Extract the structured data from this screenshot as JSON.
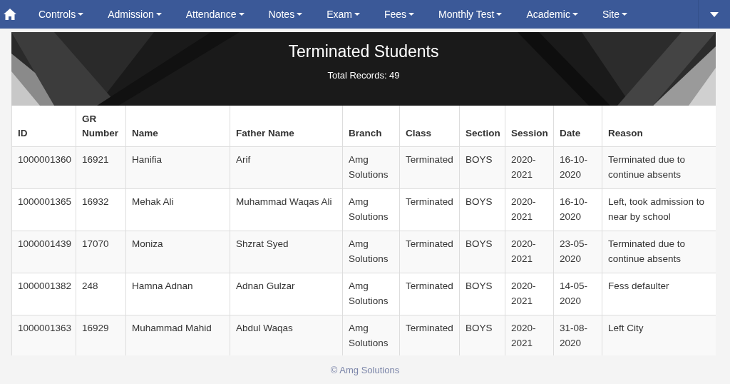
{
  "navbar": {
    "items": [
      {
        "label": "Controls"
      },
      {
        "label": "Admission"
      },
      {
        "label": "Attendance"
      },
      {
        "label": "Notes"
      },
      {
        "label": "Exam"
      },
      {
        "label": "Fees"
      },
      {
        "label": "Monthly Test"
      },
      {
        "label": "Academic"
      },
      {
        "label": "Site"
      }
    ]
  },
  "banner": {
    "title": "Terminated Students",
    "subtitle": "Total Records: 49"
  },
  "table": {
    "columns": [
      "ID",
      "GR Number",
      "Name",
      "Father Name",
      "Branch",
      "Class",
      "Section",
      "Session",
      "Date",
      "Reason"
    ],
    "rows": [
      [
        "1000001360",
        "16921",
        "Hanifia",
        "Arif",
        "Amg Solutions",
        "Terminated",
        "BOYS",
        "2020-2021",
        "16-10-2020",
        "Terminated due to continue absents"
      ],
      [
        "1000001365",
        "16932",
        "Mehak Ali",
        "Muhammad Waqas Ali",
        "Amg Solutions",
        "Terminated",
        "BOYS",
        "2020-2021",
        "16-10-2020",
        "Left, took admission to near by school"
      ],
      [
        "1000001439",
        "17070",
        "Moniza",
        "Shzrat Syed",
        "Amg Solutions",
        "Terminated",
        "BOYS",
        "2020-2021",
        "23-05-2020",
        "Terminated due to continue absents"
      ],
      [
        "1000001382",
        "248",
        "Hamna Adnan",
        "Adnan Gulzar",
        "Amg Solutions",
        "Terminated",
        "BOYS",
        "2020-2021",
        "14-05-2020",
        "Fess defaulter"
      ],
      [
        "1000001363",
        "16929",
        "Muhammad Mahid",
        "Abdul Waqas",
        "Amg Solutions",
        "Terminated",
        "BOYS",
        "2020-2021",
        "31-08-2020",
        "Left City"
      ]
    ]
  },
  "footer": {
    "text": "© Amg Solutions"
  }
}
